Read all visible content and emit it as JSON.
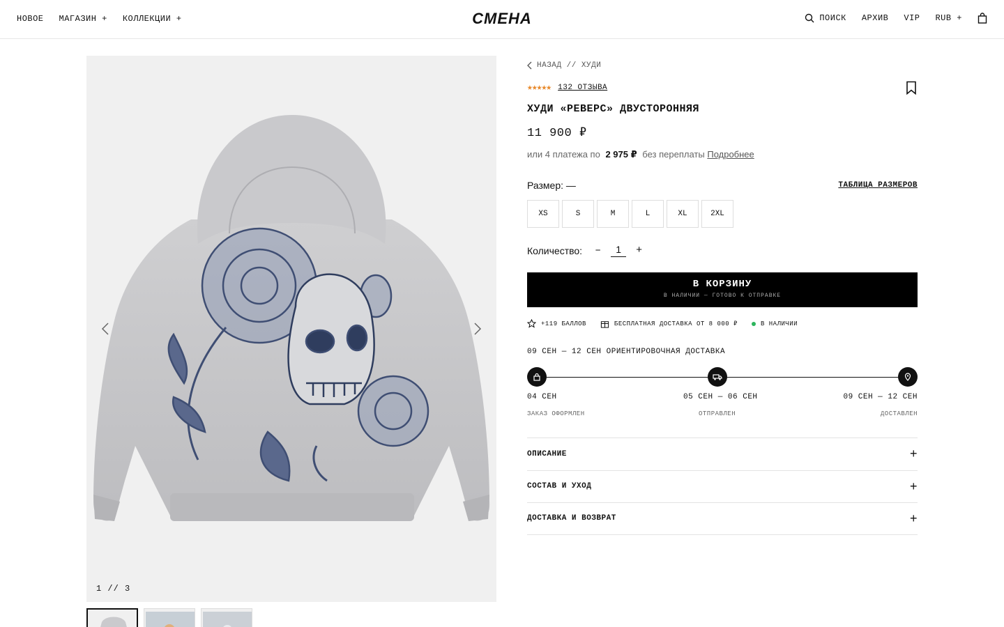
{
  "header": {
    "nav_left": [
      "НОВОЕ",
      "МАГАЗИН +",
      "КОЛЛЕКЦИИ +"
    ],
    "logo": "СМЕНА",
    "search_label": "ПОИСК",
    "archive": "АРХИВ",
    "vip": "VIP",
    "currency": "RUB +"
  },
  "gallery": {
    "counter": "1 // 3",
    "thumbnails": 3,
    "current": 1
  },
  "product": {
    "breadcrumb": "НАЗАД // ХУДИ",
    "rating_stars": 5,
    "reviews": "132 ОТЗЫВА",
    "title": "ХУДИ «РЕВЕРС» ДВУСТОРОННЯЯ",
    "price": "11 900 ₽",
    "installments_prefix": "или 4 платежа по",
    "installment_amount": "2 975 ₽",
    "installments_suffix": "без переплаты",
    "installments_link": "Подробнее",
    "size_label": "Размер: —",
    "size_table": "ТАБЛИЦА РАЗМЕРОВ",
    "sizes": [
      "XS",
      "S",
      "M",
      "L",
      "XL",
      "2XL"
    ],
    "quantity_label": "Количество:",
    "quantity": "1",
    "minus": "–",
    "plus": "+",
    "cart_button": "В КОРЗИНУ",
    "cart_sub": "В НАЛИЧИИ — ГОТОВО К ОТПРАВКЕ",
    "perks": {
      "points": "+119 БАЛЛОВ",
      "free_delivery": "БЕСПЛАТНАЯ ДОСТАВКА ОТ 8 000 ₽",
      "in_stock": "В НАЛИЧИИ"
    },
    "delivery_title": "09 СЕН — 12 СЕН ОРИЕНТИРОВОЧНАЯ ДОСТАВКА",
    "timeline": [
      {
        "date": "04 СЕН",
        "label": "ЗАКАЗ ОФОРМЛЕН",
        "icon": "lock-icon"
      },
      {
        "date": "05 СЕН — 06 СЕН",
        "label": "ОТПРАВЛЕН",
        "icon": "truck-icon"
      },
      {
        "date": "09 СЕН — 12 СЕН",
        "label": "ДОСТАВЛЕН",
        "icon": "pin-icon"
      }
    ],
    "accordion": [
      "ОПИСАНИЕ",
      "СОСТАВ И УХОД",
      "ДОСТАВКА И ВОЗВРАТ"
    ]
  },
  "colors": {
    "accent_star": "#e8892b",
    "stock_dot": "#2db55d",
    "button_bg": "#000000"
  }
}
